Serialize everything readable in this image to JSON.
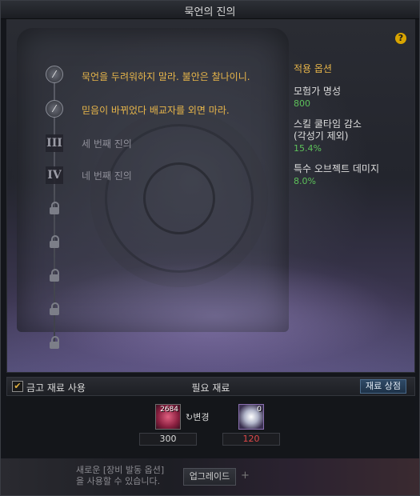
{
  "window": {
    "title": "묵언의 진의"
  },
  "help": {
    "icon": "?"
  },
  "truths": [
    {
      "label": "묵언을 두려워하지 말라. 불안은 찰나이니.",
      "state": "active"
    },
    {
      "label": "믿음이 바뀌었다 배교자를 외면 마라.",
      "state": "active"
    },
    {
      "label": "세 번째 진의",
      "state": "inactive",
      "numeral": "III"
    },
    {
      "label": "네 번째 진의",
      "state": "inactive",
      "numeral": "IV"
    }
  ],
  "options": {
    "heading": "적용 옵션",
    "items": [
      {
        "name": "모험가 명성",
        "value": "800"
      },
      {
        "name": "스킬 쿨타임 감소\n(각성기 제외)",
        "value": "15.4%"
      },
      {
        "name": "특수 오브젝트 데미지",
        "value": "8.0%"
      }
    ]
  },
  "material_bar": {
    "vault_label": "금고 재료 사용",
    "vault_checked": true,
    "required_label": "필요 재료",
    "shop_button": "재료 상점"
  },
  "materials": {
    "slot1_count": "2684",
    "change_label": "변경",
    "slot2_count": "0",
    "amount1": "300",
    "amount2": "120"
  },
  "bottom": {
    "notice_line1": "새로운 [장비 발동 옵션]",
    "notice_line2": "을 사용할 수 있습니다.",
    "upgrade_button": "업그레이드",
    "plus": "+"
  },
  "colors": {
    "accent": "#e8b64a",
    "option_value": "#5dc15a",
    "insufficient": "#e04848"
  }
}
